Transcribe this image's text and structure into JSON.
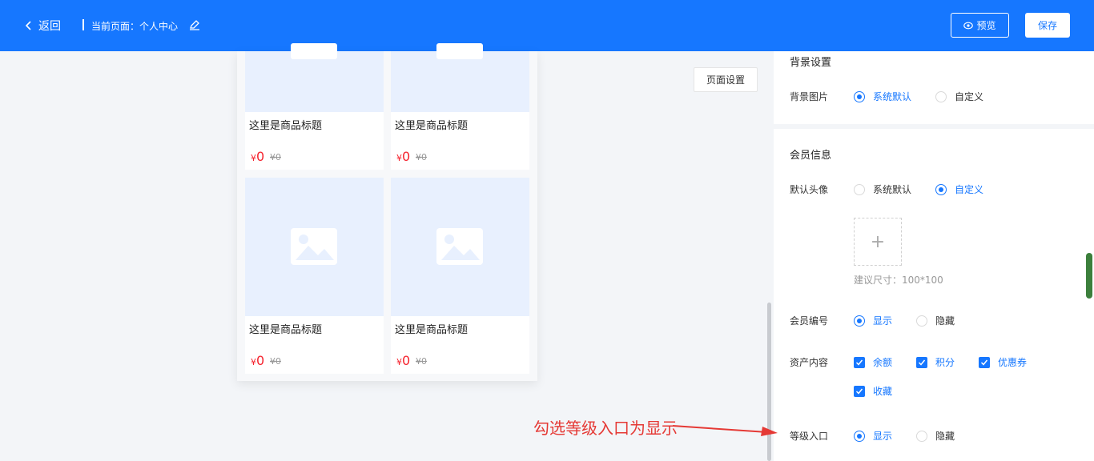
{
  "header": {
    "back_label": "返回",
    "current_page": "当前页面：个人中心",
    "preview_label": "预览",
    "save_label": "保存"
  },
  "preview": {
    "products": [
      {
        "title": "这里是商品标题",
        "currency": "¥",
        "price": "0",
        "original": "¥0"
      },
      {
        "title": "这里是商品标题",
        "currency": "¥",
        "price": "0",
        "original": "¥0"
      },
      {
        "title": "这里是商品标题",
        "currency": "¥",
        "price": "0",
        "original": "¥0"
      },
      {
        "title": "这里是商品标题",
        "currency": "¥",
        "price": "0",
        "original": "¥0"
      }
    ]
  },
  "page_settings_label": "页面设置",
  "panel": {
    "background": {
      "title": "背景设置",
      "image_label": "背景图片",
      "options": [
        "系统默认",
        "自定义"
      ],
      "selected": "系统默认"
    },
    "member": {
      "title": "会员信息",
      "avatar_label": "默认头像",
      "avatar_options": [
        "系统默认",
        "自定义"
      ],
      "avatar_selected": "自定义",
      "upload_plus": "+",
      "size_hint": "建议尺寸：100*100",
      "number_label": "会员编号",
      "number_options": [
        "显示",
        "隐藏"
      ],
      "number_selected": "显示",
      "assets_label": "资产内容",
      "assets": [
        "余额",
        "积分",
        "优惠券",
        "收藏"
      ],
      "level_label": "等级入口",
      "level_options": [
        "显示",
        "隐藏"
      ],
      "level_selected": "显示"
    }
  },
  "annotation": "勾选等级入口为显示",
  "colors": {
    "primary": "#1677ff",
    "price": "#f5222d",
    "annotation": "#e53935"
  }
}
